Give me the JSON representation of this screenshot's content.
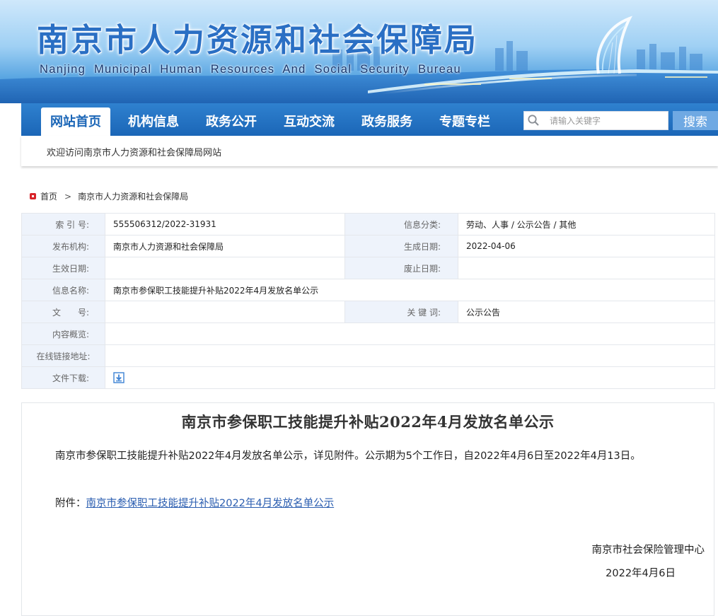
{
  "header": {
    "site_title": "南京市人力资源和社会保障局",
    "site_subtitle": "Nanjing Municipal Human Resources And Social Security Bureau"
  },
  "nav": {
    "items": [
      "网站首页",
      "机构信息",
      "政务公开",
      "互动交流",
      "政务服务",
      "专题专栏"
    ],
    "active_index": 0,
    "search_placeholder": "请输入关键字",
    "search_button": "搜索"
  },
  "welcome": "欢迎访问南京市人力资源和社会保障局网站",
  "breadcrumb": {
    "home": "首页",
    "separator": ">",
    "current": "南京市人力资源和社会保障局"
  },
  "info": {
    "index_label": "索 引 号:",
    "index_value": "555506312/2022-31931",
    "category_label": "信息分类:",
    "category_value": "劳动、人事 / 公示公告 / 其他",
    "publisher_label": "发布机构:",
    "publisher_value": "南京市人力资源和社会保障局",
    "created_label": "生成日期:",
    "created_value": "2022-04-06",
    "effective_label": "生效日期:",
    "effective_value": "",
    "expiry_label": "废止日期:",
    "expiry_value": "",
    "name_label": "信息名称:",
    "name_value": "南京市参保职工技能提升补贴2022年4月发放名单公示",
    "docno_label": "文　　号:",
    "docno_value": "",
    "keywords_label": "关 键 词:",
    "keywords_value": "公示公告",
    "summary_label": "内容概览:",
    "summary_value": "",
    "link_label": "在线链接地址:",
    "link_value": "",
    "download_label": "文件下载:"
  },
  "article": {
    "title": "南京市参保职工技能提升补贴2022年4月发放名单公示",
    "body": "南京市参保职工技能提升补贴2022年4月发放名单公示，详见附件。公示期为5个工作日，自2022年4月6日至2022年4月13日。",
    "attachment_label": "附件：",
    "attachment_link": "南京市参保职工技能提升补贴2022年4月发放名单公示",
    "signature_org": "南京市社会保险管理中心",
    "signature_date": "2022年4月6日"
  },
  "colors": {
    "nav_blue": "#1b66b7",
    "title_blue": "#2a6fc4",
    "label_bg": "#eef3fb",
    "link_blue": "#2a5db0",
    "breadcrumb_red": "#d8232a"
  },
  "icons": [
    "search-icon",
    "home-icon",
    "download-icon"
  ]
}
